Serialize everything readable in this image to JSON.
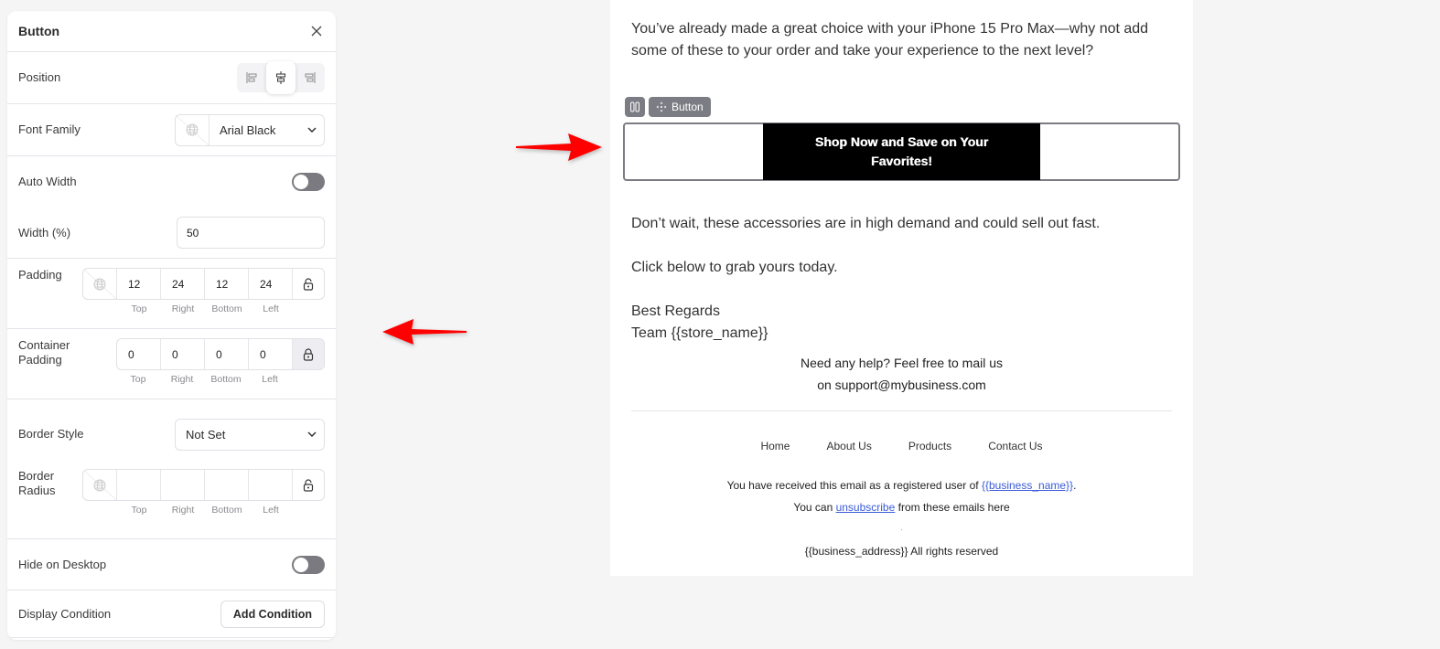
{
  "panel": {
    "title": "Button",
    "position": {
      "label": "Position",
      "options": [
        "align-left",
        "align-center",
        "align-right"
      ],
      "selected": "align-center"
    },
    "font_family": {
      "label": "Font Family",
      "value": "Arial Black"
    },
    "auto_width": {
      "label": "Auto Width",
      "enabled": false
    },
    "width": {
      "label": "Width (%)",
      "value": "50"
    },
    "padding": {
      "label": "Padding",
      "top": "12",
      "right": "24",
      "bottom": "12",
      "left": "24"
    },
    "container_padding": {
      "label_line1": "Container",
      "label_line2": "Padding",
      "top": "0",
      "right": "0",
      "bottom": "0",
      "left": "0"
    },
    "sides": {
      "top": "Top",
      "right": "Right",
      "bottom": "Bottom",
      "left": "Left"
    },
    "border_style": {
      "label": "Border Style",
      "value": "Not Set"
    },
    "border_radius": {
      "label_line1": "Border",
      "label_line2": "Radius",
      "top": "",
      "right": "",
      "bottom": "",
      "left": ""
    },
    "hide_on_desktop": {
      "label": "Hide on Desktop",
      "enabled": false
    },
    "display_condition": {
      "label": "Display Condition",
      "button": "Add Condition"
    }
  },
  "annotations": {
    "arrow_color": "#ff0000"
  },
  "email": {
    "intro": "You’ve already made a great choice with your iPhone 15 Pro Max—why not add some of these to your order and take your experience to the next level?",
    "toolbar_label": "Button",
    "cta": {
      "text": "Shop Now and Save on Your Favorites!",
      "background": "#000000",
      "color": "#ffffff"
    },
    "para1": "Don’t wait, these accessories are in high demand and could sell out fast.",
    "para2": "Click below to grab yours today.",
    "sign1": "Best Regards",
    "sign2": "Team {{store_name}}",
    "help1": "Need any help? Feel free to mail us",
    "help2": "on support@mybusiness.com",
    "nav": [
      "Home",
      "About Us",
      "Products",
      "Contact Us"
    ],
    "registered_prefix": "You have received this email as a registered user of ",
    "business_name_link": "{{business_name}}",
    "registered_suffix": ".",
    "unsub_prefix": "You can ",
    "unsub_link": "unsubscribe",
    "unsub_suffix": " from these emails here",
    "dot": ".",
    "address": "{{business_address}} All rights reserved",
    "link_color": "#3a5bd9"
  }
}
